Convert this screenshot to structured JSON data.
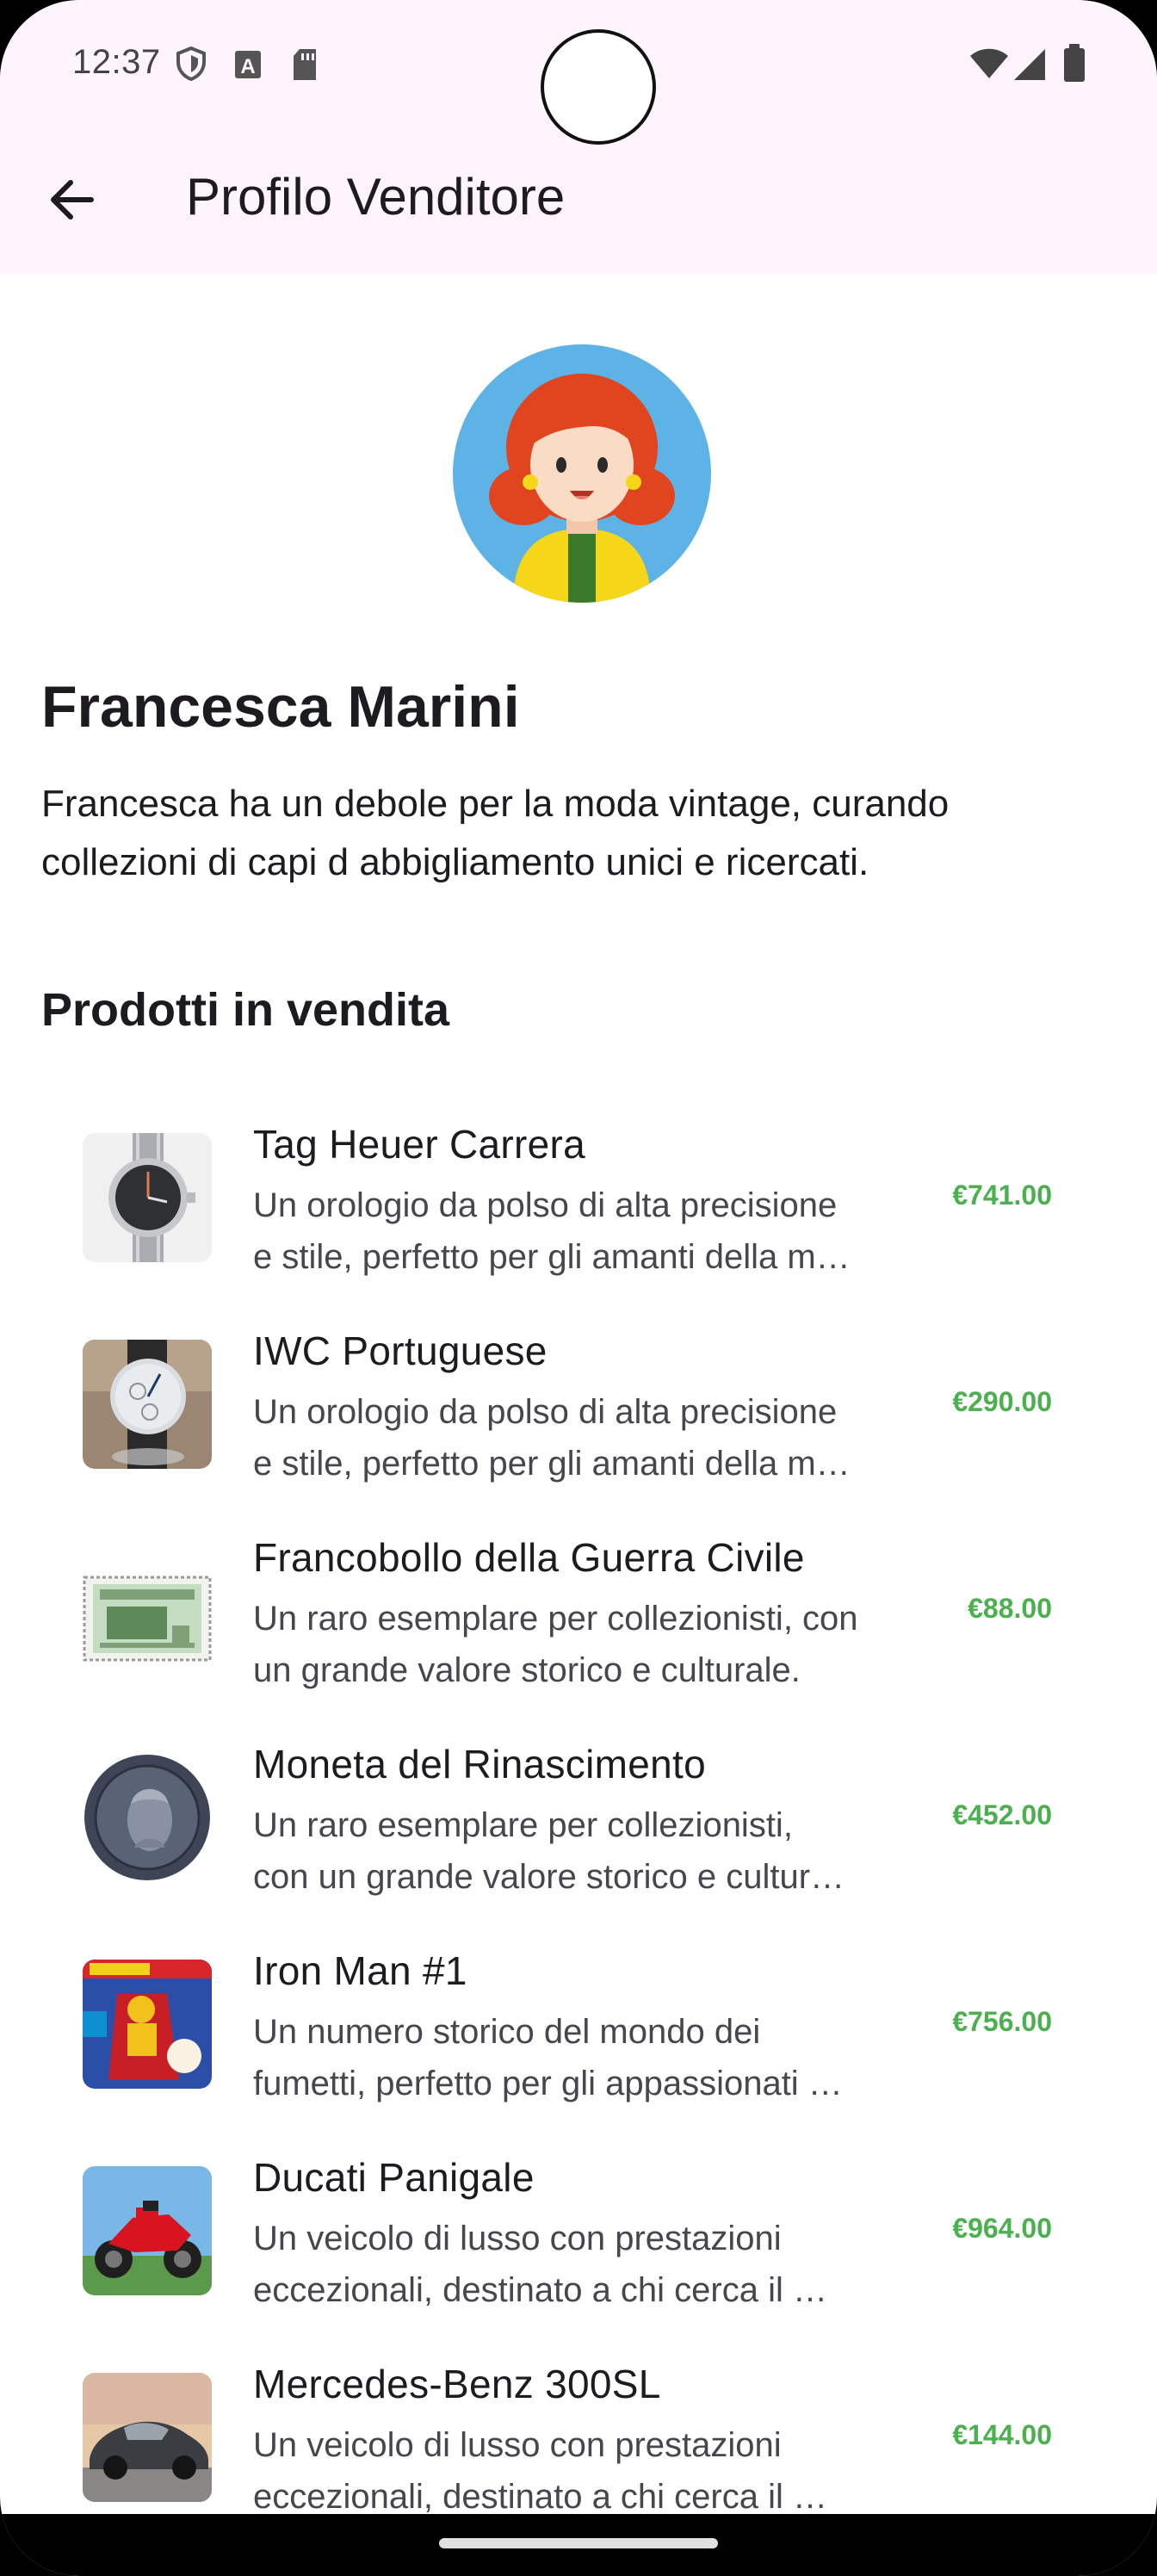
{
  "status_bar": {
    "time": "12:37",
    "left_icons": [
      "shield-icon",
      "a-badge-icon",
      "sd-card-icon"
    ],
    "right_icons": [
      "wifi-icon",
      "signal-icon",
      "battery-icon"
    ]
  },
  "app_bar": {
    "back_icon": "arrow-back-icon",
    "title": "Profilo Venditore",
    "background": "#fdf4fd"
  },
  "seller": {
    "avatar": "avatar-illustration",
    "name": "Francesca Marini",
    "bio_lines": [
      "Francesca ha un debole per la moda vintage, curando",
      "collezioni di capi d abbigliamento unici e ricercati."
    ]
  },
  "products_section": {
    "title": "Prodotti in vendita",
    "items": [
      {
        "title": "Tag Heuer Carrera",
        "desc": [
          "Un orologio da polso di alta precisione",
          "e stile, perfetto per gli amanti della m…"
        ],
        "price": "€741.00",
        "image": "watch-image"
      },
      {
        "title": "IWC Portuguese",
        "desc": [
          "Un orologio da polso di alta precisione",
          "e stile, perfetto per gli amanti della m…"
        ],
        "price": "€290.00",
        "image": "watch-image"
      },
      {
        "title": "Francobollo della Guerra Civile",
        "desc": [
          "Un raro esemplare per collezionisti, con",
          "un grande valore storico e culturale."
        ],
        "price": "€88.00",
        "image": "stamp-image"
      },
      {
        "title": "Moneta del Rinascimento",
        "desc": [
          "Un raro esemplare per collezionisti,",
          "con un grande valore storico e cultur…"
        ],
        "price": "€452.00",
        "image": "coin-image"
      },
      {
        "title": "Iron Man #1",
        "desc": [
          "Un numero storico del mondo dei",
          "fumetti, perfetto per gli appassionati …"
        ],
        "price": "€756.00",
        "image": "comic-image"
      },
      {
        "title": "Ducati Panigale",
        "desc": [
          "Un veicolo di lusso con prestazioni",
          "eccezionali, destinato a chi cerca il …"
        ],
        "price": "€964.00",
        "image": "motorcycle-image"
      },
      {
        "title": "Mercedes-Benz 300SL",
        "desc": [
          "Un veicolo di lusso con prestazioni",
          "eccezionali, destinato a chi cerca il …"
        ],
        "price": "€144.00",
        "image": "car-image"
      }
    ]
  },
  "colors": {
    "price": "#4caf50",
    "title_text": "#1d1b20",
    "secondary_text": "#49454f"
  }
}
